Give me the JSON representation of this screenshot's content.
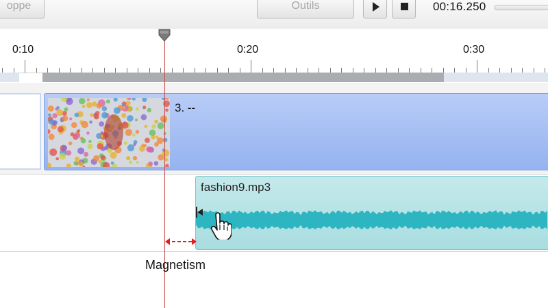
{
  "toolbar": {
    "left_button_label": "oppe",
    "outils_label": "Outils",
    "time": "00:16.250"
  },
  "ruler": {
    "labels": [
      "0:10",
      "0:20",
      "0:30"
    ]
  },
  "video_track": {
    "clip_title": "3. --"
  },
  "audio_track": {
    "clip_title": "fashion9.mp3"
  },
  "annotation": {
    "label": "Magnetism"
  },
  "icons": [
    "play-icon",
    "stop-icon",
    "playhead-icon",
    "trim-arrow-icon",
    "hand-cursor-icon"
  ],
  "colors": {
    "video_clip": "#a6c0f4",
    "audio_clip": "#b6e3e6",
    "waveform": "#2eb5c2",
    "playhead": "#c84a4a",
    "magnetism_arrow": "#e02020"
  }
}
